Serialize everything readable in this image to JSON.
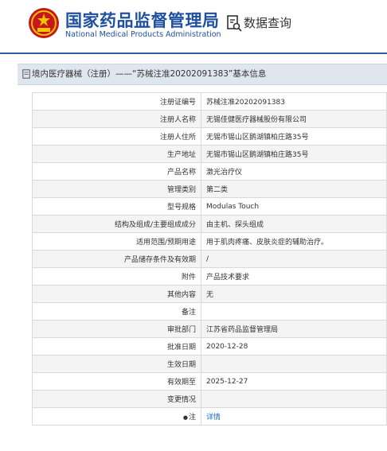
{
  "header": {
    "org_name_cn": "国家药品监督管理局",
    "org_name_en": "National Medical Products Administration",
    "data_query": "数据查询",
    "brand_color": "#1f4fa0"
  },
  "page_title": "境内医疗器械（注册）——“苏械注准20202091383”基本信息",
  "fields": [
    {
      "label": "注册证编号",
      "value": "苏械注准20202091383"
    },
    {
      "label": "注册人名称",
      "value": "无锡佳健医疗器械股份有限公司"
    },
    {
      "label": "注册人住所",
      "value": "无锡市锡山区鹅湖镇柏庄路35号"
    },
    {
      "label": "生产地址",
      "value": "无锡市锡山区鹅湖镇柏庄路35号"
    },
    {
      "label": "产品名称",
      "value": "激光治疗仪"
    },
    {
      "label": "管理类别",
      "value": "第二类"
    },
    {
      "label": "型号规格",
      "value": "Modulas Touch"
    },
    {
      "label": "结构及组成/主要组成成分",
      "value": "由主机、探头组成"
    },
    {
      "label": "适用范围/预期用途",
      "value": "用于肌肉疼痛、皮肤炎症的辅助治疗。"
    },
    {
      "label": "产品储存条件及有效期",
      "value": "/"
    },
    {
      "label": "附件",
      "value": "产品技术要求"
    },
    {
      "label": "其他内容",
      "value": "无"
    },
    {
      "label": "备注",
      "value": ""
    },
    {
      "label": "审批部门",
      "value": "江苏省药品监督管理局"
    },
    {
      "label": "批准日期",
      "value": "2020-12-28"
    },
    {
      "label": "生效日期",
      "value": ""
    },
    {
      "label": "有效期至",
      "value": "2025-12-27"
    },
    {
      "label": "变更情况",
      "value": ""
    }
  ],
  "note_row": {
    "label": "注",
    "link_text": "详情"
  }
}
